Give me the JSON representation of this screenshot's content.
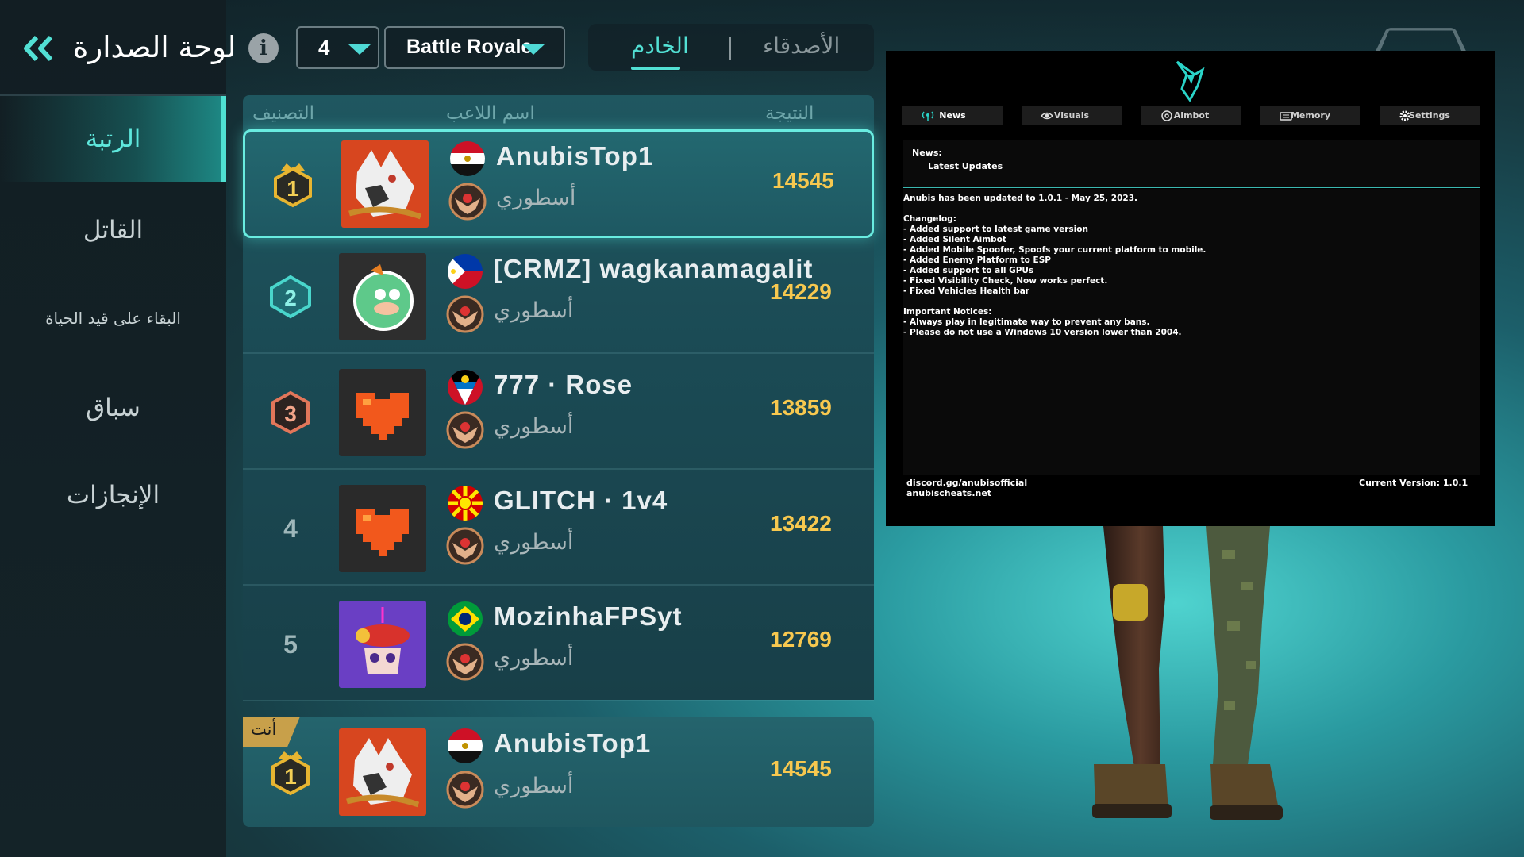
{
  "sidebar": {
    "items": [
      {
        "label": "الرتبة",
        "active": true
      },
      {
        "label": "القاتل",
        "active": false
      },
      {
        "label": "البقاء على قيد الحياة",
        "active": false
      },
      {
        "label": "سباق",
        "active": false
      },
      {
        "label": "الإنجازات",
        "active": false
      }
    ]
  },
  "header": {
    "title": "لوحة الصدارة",
    "back_icon": "double-chevron-left-icon",
    "info_icon": "info-icon",
    "squad_select": {
      "value": "4"
    },
    "mode_select": {
      "value": "Battle Royale"
    },
    "tabs": [
      {
        "label": "الخادم",
        "active": true
      },
      {
        "label": "الأصدقاء",
        "active": false
      }
    ]
  },
  "leaderboard": {
    "columns": {
      "rank": "التصنيف",
      "player": "اسم اللاعب",
      "score": "النتيجة"
    },
    "rows": [
      {
        "rank": "1",
        "name": "AnubisTop1",
        "tier": "أسطوري",
        "score": "14545",
        "flag": "egypt",
        "avatar": "wolf"
      },
      {
        "rank": "2",
        "name": "[CRMZ] wagkanamagalit",
        "tier": "أسطوري",
        "score": "14229",
        "flag": "philippines",
        "avatar": "green-bird"
      },
      {
        "rank": "3",
        "name": "777 · Rose",
        "tier": "أسطوري",
        "score": "13859",
        "flag": "antigua-and-barbuda",
        "avatar": "pixel-heart"
      },
      {
        "rank": "4",
        "name": "GLITCH · 1v4",
        "tier": "أسطوري",
        "score": "13422",
        "flag": "north-macedonia",
        "avatar": "pixel-heart"
      },
      {
        "rank": "5",
        "name": "MozinhaFPSyt",
        "tier": "أسطوري",
        "score": "12769",
        "flag": "brazil",
        "avatar": "robot-skull"
      }
    ],
    "me": {
      "tag": "أنت",
      "rank": "1",
      "name": "AnubisTop1",
      "tier": "أسطوري",
      "score": "14545",
      "flag": "egypt",
      "avatar": "wolf"
    }
  },
  "overlay": {
    "tabs": [
      {
        "label": "News",
        "icon": "antenna-icon",
        "active": true
      },
      {
        "label": "Visuals",
        "icon": "eye-icon",
        "active": false
      },
      {
        "label": "Aimbot",
        "icon": "crosshair-icon",
        "active": false
      },
      {
        "label": "Memory",
        "icon": "keyboard-icon",
        "active": false
      },
      {
        "label": "Settings",
        "icon": "gear-icon",
        "active": false
      }
    ],
    "news_heading": "News:",
    "news_sub": "Latest Updates",
    "update_line": "Anubis has been updated to 1.0.1 - May 25, 2023.",
    "changelog_heading": "Changelog:",
    "changelog": [
      "- Added support to latest game version",
      "- Added Silent Aimbot",
      "- Added Mobile Spoofer, Spoofs your current platform to mobile.",
      "- Added Enemy Platform to ESP",
      "- Added support to all GPUs",
      "- Fixed Visibility Check, Now works perfect.",
      "- Fixed Vehicles Health bar"
    ],
    "notices_heading": "Important Notices:",
    "notices": [
      "- Always play in legitimate way to prevent any bans.",
      "- Please do not use a Windows 10 version lower than 2004."
    ],
    "footer_left": [
      "discord.gg/anubisofficial",
      "anubischeats.net"
    ],
    "footer_right": "Current Version: 1.0.1"
  }
}
